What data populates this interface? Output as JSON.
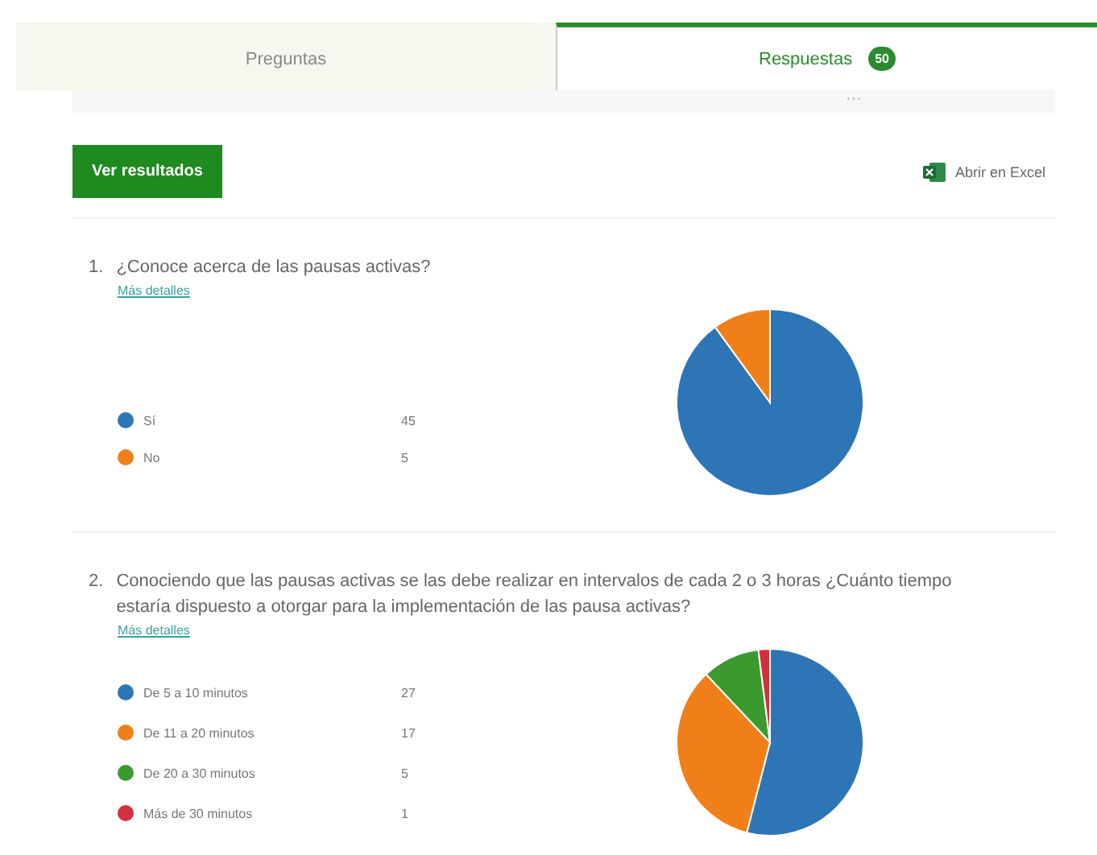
{
  "tabs": [
    {
      "label": "Preguntas",
      "selected": false
    },
    {
      "label": "Respuestas",
      "selected": true,
      "badge": "50"
    }
  ],
  "more": "···",
  "toolbar": {
    "results_button": "Ver resultados",
    "excel_link": "Abrir en Excel"
  },
  "questions": [
    {
      "number": "1.",
      "title": "¿Conoce acerca de las pausas activas?",
      "details_link": "Más detalles",
      "options": [
        {
          "label": "Sí",
          "count": "45",
          "color": "#2e75b6"
        },
        {
          "label": "No",
          "count": "5",
          "color": "#f07f1a"
        }
      ],
      "chart_data": {
        "type": "pie",
        "values": [
          90,
          10
        ]
      }
    },
    {
      "number": "2.",
      "title": "Conociendo que las pausas activas se las debe realizar en intervalos de cada 2 o 3 horas ¿Cuánto tiempo estaría dispuesto a otorgar para la implementación de las pausa activas?",
      "details_link": "Más detalles",
      "options": [
        {
          "label": "De 5 a 10 minutos",
          "count": "27",
          "color": "#2e75b6"
        },
        {
          "label": "De 11 a 20 minutos",
          "count": "17",
          "color": "#f07f1a"
        },
        {
          "label": "De 20 a 30 minutos",
          "count": "5",
          "color": "#3a9a2e"
        },
        {
          "label": "Más de 30 minutos",
          "count": "1",
          "color": "#d0313d"
        }
      ],
      "chart_data": {
        "type": "pie",
        "values": [
          54,
          34,
          10,
          2
        ]
      }
    }
  ]
}
